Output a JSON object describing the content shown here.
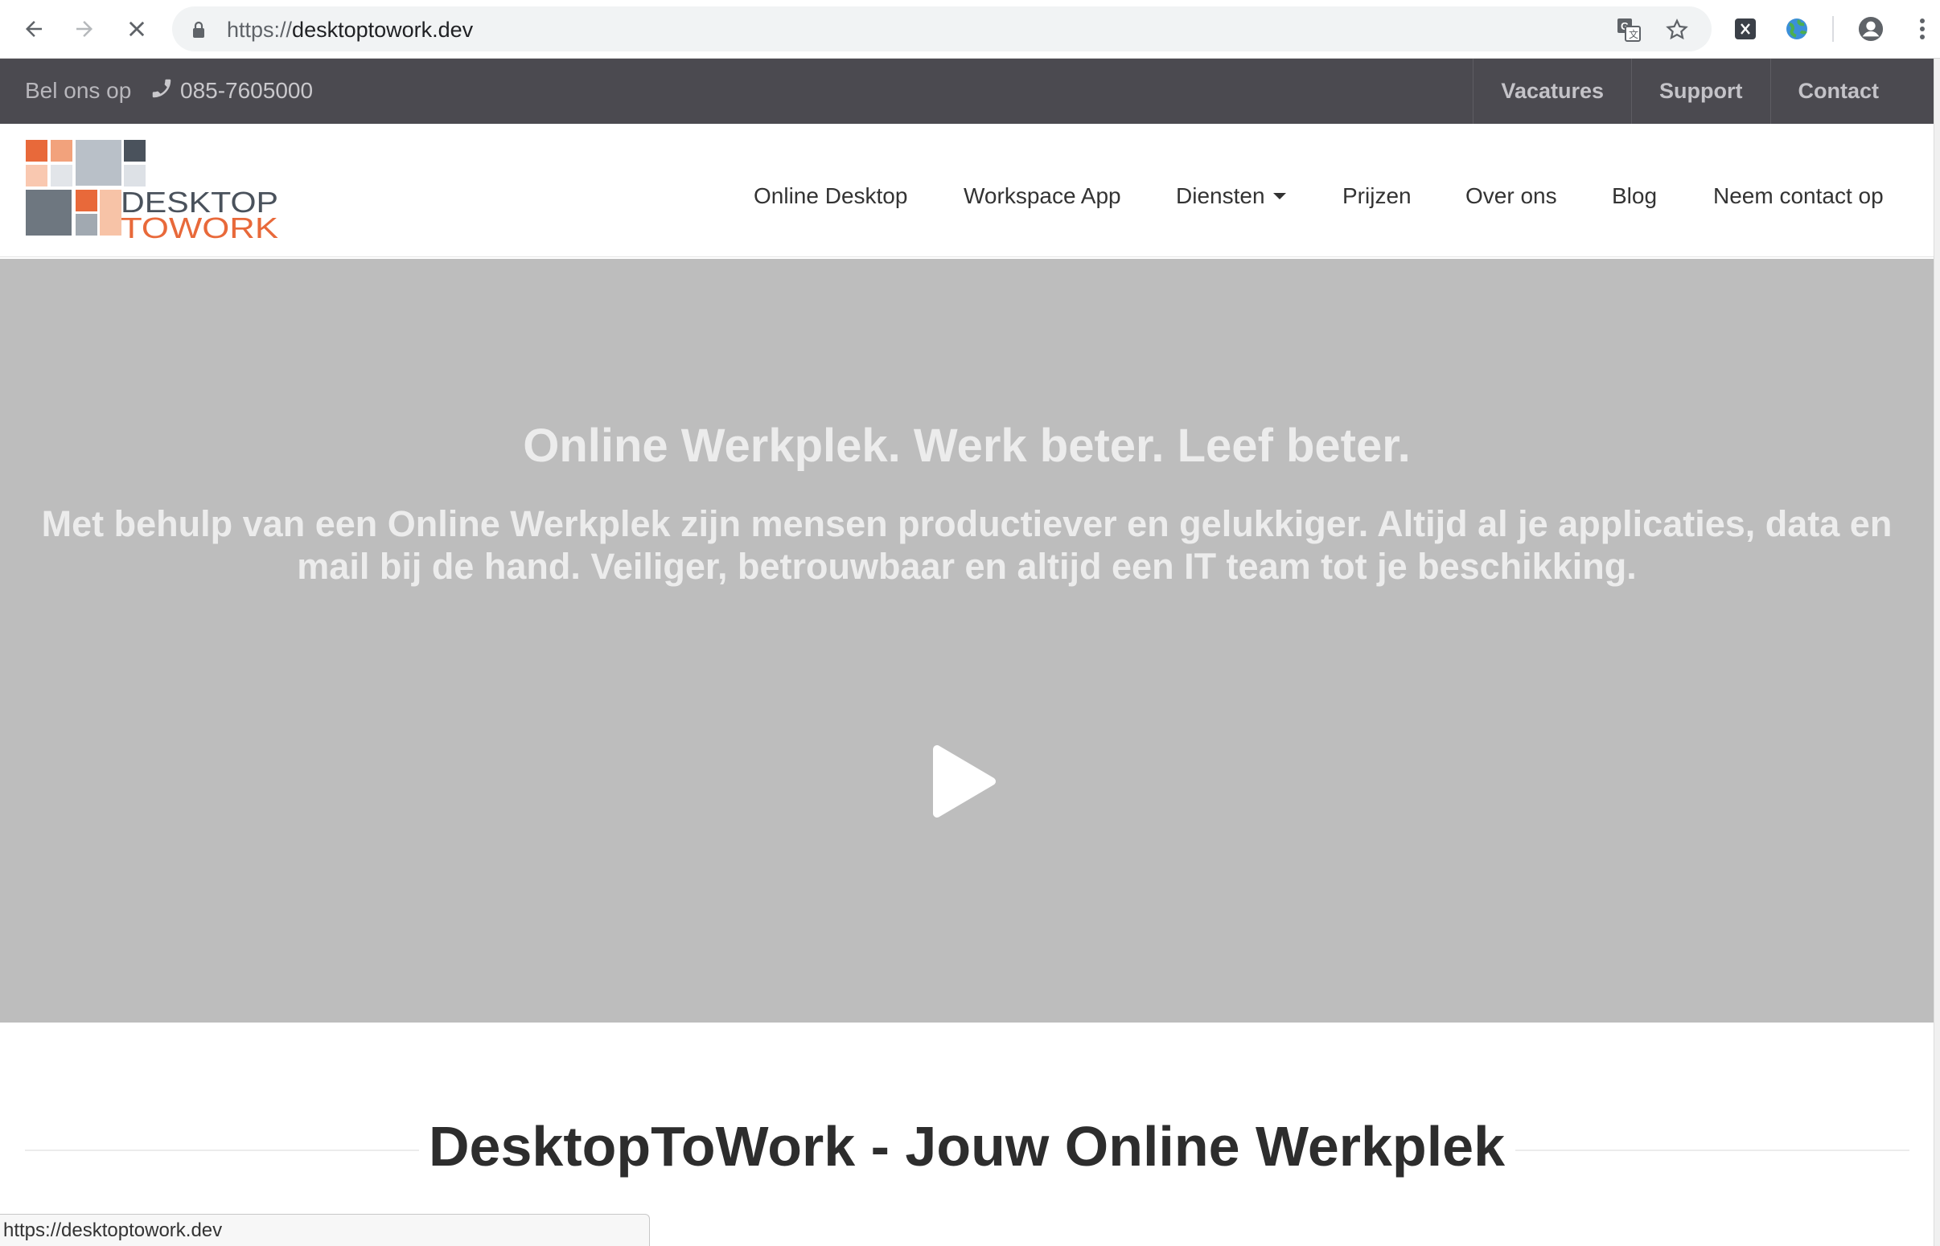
{
  "browser": {
    "url_scheme": "https://",
    "url_host": "desktoptowork.dev",
    "status_url": "https://desktoptowork.dev",
    "icons": [
      "back-icon",
      "forward-icon",
      "stop-icon",
      "lock-icon",
      "translate-icon",
      "star-icon",
      "extension-x-icon",
      "extension-globe-icon",
      "profile-icon",
      "menu-icon"
    ]
  },
  "topbar": {
    "call_label": "Bel ons op",
    "phone": "085-7605000",
    "links": [
      "Vacatures",
      "Support",
      "Contact"
    ]
  },
  "logo": {
    "line1": "DESKTOP",
    "line2": "TOWORK"
  },
  "nav": {
    "items": [
      "Online Desktop",
      "Workspace App",
      "Diensten",
      "Prijzen",
      "Over ons",
      "Blog",
      "Neem contact op"
    ]
  },
  "hero": {
    "title": "Online Werkplek. Werk beter. Leef beter.",
    "subtitle": "Met behulp van een Online Werkplek zijn mensen productiever en gelukkiger. Altijd al je applicaties, data en mail bij de hand. Veiliger, betrouwbaar en altijd een IT team tot je beschikking."
  },
  "section": {
    "title": "DesktopToWork - Jouw Online Werkplek"
  },
  "colors": {
    "topbar_bg": "#4b4a50",
    "hero_bg": "#bdbdbd",
    "logo_orange": "#e8693a",
    "logo_slate": "#4a525c"
  }
}
